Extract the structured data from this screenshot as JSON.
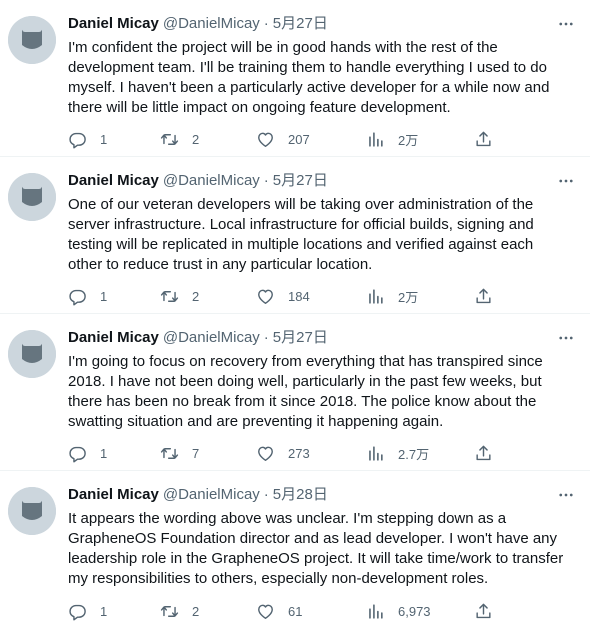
{
  "tweets": [
    {
      "name": "Daniel Micay",
      "handle": "@DanielMicay",
      "dot": "·",
      "date": "5月27日",
      "text": "I'm confident the project will be in good hands with the rest of the development team. I'll be training them to handle everything I used to do myself. I haven't been a particularly active developer for a while now and there will be little impact on ongoing feature development.",
      "replies": "1",
      "retweets": "2",
      "likes": "207",
      "views": "2万"
    },
    {
      "name": "Daniel Micay",
      "handle": "@DanielMicay",
      "dot": "·",
      "date": "5月27日",
      "text": "One of our veteran developers will be taking over administration of the server infrastructure. Local infrastructure for official builds, signing and testing will be replicated in multiple locations and verified against each other to reduce trust in any particular location.",
      "replies": "1",
      "retweets": "2",
      "likes": "184",
      "views": "2万"
    },
    {
      "name": "Daniel Micay",
      "handle": "@DanielMicay",
      "dot": "·",
      "date": "5月27日",
      "text": "I'm going to focus on recovery from everything that has transpired since 2018. I have not been doing well, particularly in the past few weeks, but there has been no break from it since 2018. The police know about the swatting situation and are preventing it happening again.",
      "replies": "1",
      "retweets": "7",
      "likes": "273",
      "views": "2.7万"
    },
    {
      "name": "Daniel Micay",
      "handle": "@DanielMicay",
      "dot": "·",
      "date": "5月28日",
      "text": "It appears the wording above was unclear. I'm stepping down as a GrapheneOS Foundation director and as lead developer. I won't have any leadership role in the GrapheneOS project. It will take time/work to transfer my responsibilities to others, especially non-development roles.",
      "replies": "1",
      "retweets": "2",
      "likes": "61",
      "views": "6,973"
    }
  ],
  "icons": {
    "avatar": "default-avatar-icon",
    "more": "more-horizontal-icon",
    "reply": "reply-icon",
    "retweet": "retweet-icon",
    "like": "heart-icon",
    "views": "views-chart-icon",
    "share": "share-icon"
  },
  "colors": {
    "text": "#0f1419",
    "secondary": "#536471",
    "divider": "#eff3f4",
    "avatar_bg": "#ccd6dd",
    "avatar_fg": "#66757f"
  }
}
